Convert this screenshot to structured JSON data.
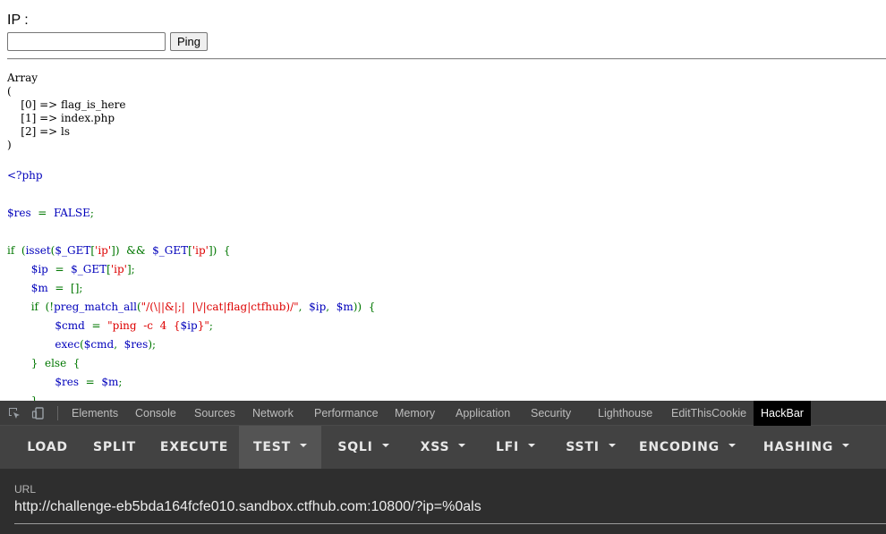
{
  "form": {
    "ip_label": "IP :",
    "ip_input_value": "",
    "ping_label": "Ping"
  },
  "output": {
    "array_text": "Array\n(\n    [0] => flag_is_here\n    [1] => index.php\n    [2] => ls\n)"
  },
  "source_code": {
    "lines": [
      [
        [
          "<?php",
          "dflt"
        ]
      ],
      [],
      [
        [
          "$res",
          "dflt"
        ],
        [
          "  =  ",
          "kw"
        ],
        [
          "FALSE",
          "dflt"
        ],
        [
          ";",
          "kw"
        ]
      ],
      [],
      [
        [
          "if  (",
          "kw"
        ],
        [
          "isset",
          "dflt"
        ],
        [
          "(",
          "kw"
        ],
        [
          "$_GET",
          "dflt"
        ],
        [
          "[",
          "kw"
        ],
        [
          "'ip'",
          "str"
        ],
        [
          "])  &&  ",
          "kw"
        ],
        [
          "$_GET",
          "dflt"
        ],
        [
          "[",
          "kw"
        ],
        [
          "'ip'",
          "str"
        ],
        [
          "])  {",
          "kw"
        ]
      ],
      [
        [
          "       ",
          "kw"
        ],
        [
          "$ip",
          "dflt"
        ],
        [
          "  =  ",
          "kw"
        ],
        [
          "$_GET",
          "dflt"
        ],
        [
          "[",
          "kw"
        ],
        [
          "'ip'",
          "str"
        ],
        [
          "];",
          "kw"
        ]
      ],
      [
        [
          "       ",
          "kw"
        ],
        [
          "$m",
          "dflt"
        ],
        [
          "  =  [];",
          "kw"
        ]
      ],
      [
        [
          "       ",
          "kw"
        ],
        [
          "if  (!",
          "kw"
        ],
        [
          "preg_match_all",
          "dflt"
        ],
        [
          "(",
          "kw"
        ],
        [
          "\"/(\\||&|;|  |\\/|cat|flag|ctfhub)/\"",
          "str"
        ],
        [
          ",  ",
          "kw"
        ],
        [
          "$ip",
          "dflt"
        ],
        [
          ",  ",
          "kw"
        ],
        [
          "$m",
          "dflt"
        ],
        [
          "))  {",
          "kw"
        ]
      ],
      [
        [
          "              ",
          "kw"
        ],
        [
          "$cmd",
          "dflt"
        ],
        [
          "  =  ",
          "kw"
        ],
        [
          "\"ping  -c  4  {",
          "str"
        ],
        [
          "$ip",
          "dflt"
        ],
        [
          "}\"",
          "str"
        ],
        [
          ";",
          "kw"
        ]
      ],
      [
        [
          "              ",
          "kw"
        ],
        [
          "exec",
          "dflt"
        ],
        [
          "(",
          "kw"
        ],
        [
          "$cmd",
          "dflt"
        ],
        [
          ",  ",
          "kw"
        ],
        [
          "$res",
          "dflt"
        ],
        [
          ");",
          "kw"
        ]
      ],
      [
        [
          "       ",
          "kw"
        ],
        [
          "}  else  {",
          "kw"
        ]
      ],
      [
        [
          "              ",
          "kw"
        ],
        [
          "$res",
          "dflt"
        ],
        [
          "  =  ",
          "kw"
        ],
        [
          "$m",
          "dflt"
        ],
        [
          ";",
          "kw"
        ]
      ],
      [
        [
          "       ",
          "kw"
        ],
        [
          "}",
          "kw"
        ]
      ]
    ]
  },
  "devtools": {
    "tabs": [
      "Elements",
      "Console",
      "Sources",
      "Network",
      "Performance",
      "Memory",
      "Application",
      "Security",
      "Lighthouse",
      "EditThisCookie",
      "HackBar"
    ],
    "active_tab": "HackBar",
    "colors": {
      "panel_bg": "#242424",
      "toolbar_bg": "#424242",
      "tabbar_bg": "#3c3c3c",
      "active_tab_bg": "#000000"
    }
  },
  "hackbar": {
    "buttons": [
      {
        "label": "LOAD",
        "dropdown": false
      },
      {
        "label": "SPLIT",
        "dropdown": false
      },
      {
        "label": "EXECUTE",
        "dropdown": false
      },
      {
        "label": "TEST",
        "dropdown": true
      },
      {
        "label": "SQLI",
        "dropdown": true
      },
      {
        "label": "XSS",
        "dropdown": true
      },
      {
        "label": "LFI",
        "dropdown": true
      },
      {
        "label": "SSTI",
        "dropdown": true
      },
      {
        "label": "ENCODING",
        "dropdown": true
      },
      {
        "label": "HASHING",
        "dropdown": true
      }
    ],
    "url_label": "URL",
    "url_value": "http://challenge-eb5bda164fcfe010.sandbox.ctfhub.com:10800/?ip=%0als"
  },
  "code_colors": {
    "dflt": "#0000bb",
    "kw": "#007700",
    "str": "#dd0000"
  }
}
